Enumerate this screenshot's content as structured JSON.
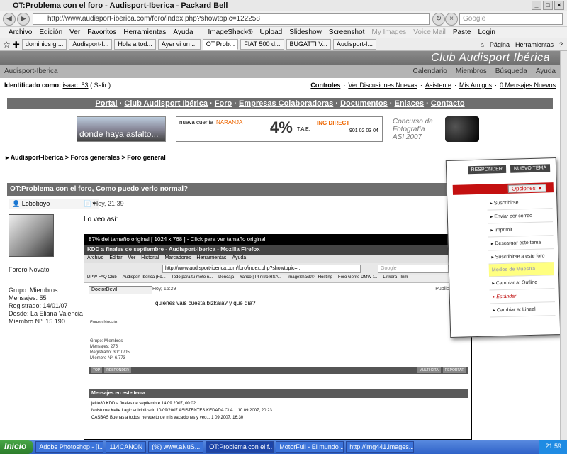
{
  "window": {
    "title": "OT:Problema con el foro - Audisport-Iberica - Packard Bell"
  },
  "nav": {
    "url": "http://www.audisport-iberica.com/foro/index.php?showtopic=122258",
    "search_placeholder": "Google"
  },
  "menu": [
    "Archivo",
    "Edición",
    "Ver",
    "Favoritos",
    "Herramientas",
    "Ayuda",
    "ImageShack®",
    "Upload",
    "Slideshow",
    "Screenshot",
    "My Images",
    "Voice Mail",
    "Paste",
    "Login"
  ],
  "tabs": [
    "dominios gr...",
    "Audisport-I...",
    "Hola a tod...",
    "Ayer vi un ...",
    "OT:Prob...",
    "FIAT 500 d...",
    "BUGATTI V...",
    "Audisport-I..."
  ],
  "tabs_right": [
    "Página",
    "Herramientas"
  ],
  "site": {
    "club": "Club Audisport Ibérica",
    "name": "Audisport-Iberica",
    "nav": [
      "Calendario",
      "Miembros",
      "Búsqueda",
      "Ayuda"
    ]
  },
  "user": {
    "label": "Identificado como:",
    "name": "isaac_53",
    "salir": "( Salir )",
    "links": [
      "Controles",
      "·",
      "Ver Discusiones Nuevas",
      "·",
      "Asistente",
      "·",
      "Mis Amigos",
      "·",
      "0 Mensajes Nuevos"
    ]
  },
  "portal": [
    "Portal",
    "·",
    "Club Audisport Ibérica",
    "·",
    "Foro",
    "·",
    "Empresas Colaboradoras",
    "·",
    "Documentos",
    "·",
    "Enlaces",
    "·",
    "Contacto"
  ],
  "banners": {
    "b1": "donde haya asfalto...",
    "b2": {
      "line1": "nueva cuenta",
      "line2": "NARANJA",
      "rate": "4%",
      "tae": "T.A.E.",
      "bank": "ING DIRECT",
      "phone": "901 02 03 04"
    },
    "b3": {
      "line1": "Concurso de",
      "line2": "Fotografía",
      "line3": "ASI 2007"
    }
  },
  "breadcrumb": "Audisport-Iberica > Foros generales > Foro general",
  "topic": {
    "title": "OT:Problema con el foro, Como puedo verlo normal?"
  },
  "post": {
    "author": "Loboboyo",
    "date": "Hoy, 21:39",
    "rank": "Forero Novato",
    "stats": [
      "Grupo: Miembros",
      "Mensajes: 55",
      "Registrado: 14/01/07",
      "Desde: La Eliana Valencia",
      "Miembro Nº: 15.190"
    ],
    "text": "Lo veo asi:"
  },
  "shot": {
    "header": "87% del tamaño original [ 1024 x 768 ] - Click para ver tamaño original",
    "title": "KDD a finales de septiembre - Audisport-Iberica - Mozilla Firefox",
    "menu": [
      "Archivo",
      "Editar",
      "Ver",
      "Historial",
      "Marcadores",
      "Herramientas",
      "Ayuda"
    ],
    "url": "http://www.audisport-iberica.com/foro/index.php?showtopic=...",
    "search": "Google",
    "bookmarks": [
      "DPW FAQ Club",
      "Audisport-Iberica (Fo...",
      "Todo para tu moto n...",
      "Dencaja",
      "Yanco | PI nitro RSA...",
      "ImageShack® - Hosting",
      "Foro Gente DMW :...",
      "Linkera - Inm"
    ],
    "user": "DoctorDevil",
    "date": "Hoy, 16:29",
    "pub": "Publicado",
    "question": "quienes vais cuesta bizkaia? y que día?",
    "rank": "Forero Novato",
    "info": [
      "Grupo: Miembros",
      "Mensajes: 275",
      "Registrado: 30/10/05",
      "Miembro Nº: 6.773"
    ],
    "btns": [
      "TOP",
      "RESPONDER",
      "MULTI CITA",
      "REPORTAR"
    ],
    "msg_title": "Mensajes en este tema",
    "rows": [
      "jelite80  KDD a finales de septiembre  14.09.2007, 00:02",
      "Nolsturne Kelfe  Lagic adiciolizado 10/09/2007 ASISTENTES KEDADA CLA...  10.09.2007, 20:23",
      "CASBAS  Buenas a todos, he vuelto de mis vacaciones y veo...  1 09 2007, 16:30"
    ]
  },
  "popup": {
    "responder": "RESPONDER",
    "nuevo": "NUEVO TEMA",
    "opciones": "Opciones ▼",
    "items": [
      "Suscribirse",
      "Enviar por correo",
      "Imprimir",
      "Descargar este tema",
      "Suscribirse a este foro",
      "Modos de Muestra",
      "Cambiar a: Outline",
      "Estándar",
      "Cambiar a: Lineal+"
    ]
  },
  "taskbar": {
    "start": "Inicio",
    "tasks": [
      "Adobe Photoshop - [I...",
      "114CANON",
      "(%) www.aNuS...",
      "OT:Problema con el f...",
      "MotorFull - El mundo ...",
      "http://img441.images..."
    ],
    "clock": "21:59"
  }
}
